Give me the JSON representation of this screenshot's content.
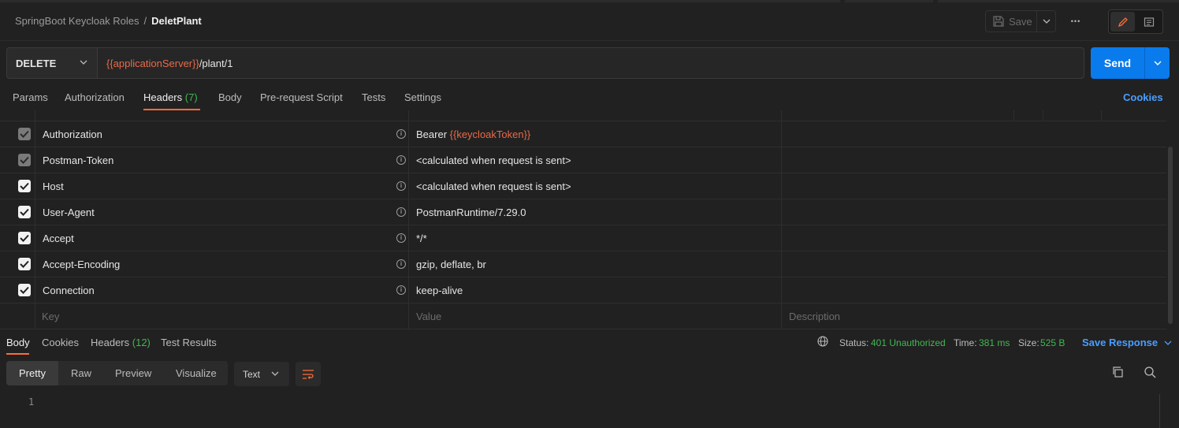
{
  "breadcrumb": {
    "collection": "SpringBoot Keycloak Roles",
    "separator": "/",
    "request": "DeletPlant"
  },
  "header": {
    "save_label": "Save",
    "more": "•••"
  },
  "request": {
    "method": "DELETE",
    "url_var": "{{applicationServer}}",
    "url_path": "/plant/1",
    "send_label": "Send"
  },
  "req_tabs": {
    "params": "Params",
    "authorization": "Authorization",
    "headers": "Headers",
    "headers_count": "(7)",
    "body": "Body",
    "prerequest": "Pre-request Script",
    "tests": "Tests",
    "settings": "Settings",
    "cookies": "Cookies"
  },
  "headers_table": {
    "rows": [
      {
        "key": "Authorization",
        "value_prefix": "Bearer ",
        "value_var": "{{keycloakToken}}"
      },
      {
        "key": "Postman-Token",
        "value": "<calculated when request is sent>"
      },
      {
        "key": "Host",
        "value": "<calculated when request is sent>"
      },
      {
        "key": "User-Agent",
        "value": "PostmanRuntime/7.29.0"
      },
      {
        "key": "Accept",
        "value": "*/*"
      },
      {
        "key": "Accept-Encoding",
        "value": "gzip, deflate, br"
      },
      {
        "key": "Connection",
        "value": "keep-alive"
      }
    ],
    "placeholders": {
      "key": "Key",
      "value": "Value",
      "description": "Description"
    }
  },
  "response": {
    "tabs": {
      "body": "Body",
      "cookies": "Cookies",
      "headers": "Headers",
      "headers_count": "(12)",
      "test_results": "Test Results"
    },
    "status_label": "Status:",
    "status_value": "401 Unauthorized",
    "time_label": "Time:",
    "time_value": "381 ms",
    "size_label": "Size:",
    "size_value": "525 B",
    "save_response": "Save Response",
    "formats": {
      "pretty": "Pretty",
      "raw": "Raw",
      "preview": "Preview",
      "visualize": "Visualize"
    },
    "type": "Text",
    "line_number": "1"
  },
  "colors": {
    "accent": "#ff6c37",
    "primary": "#097bed",
    "success": "#3fb950",
    "variable": "#e86a4a"
  }
}
